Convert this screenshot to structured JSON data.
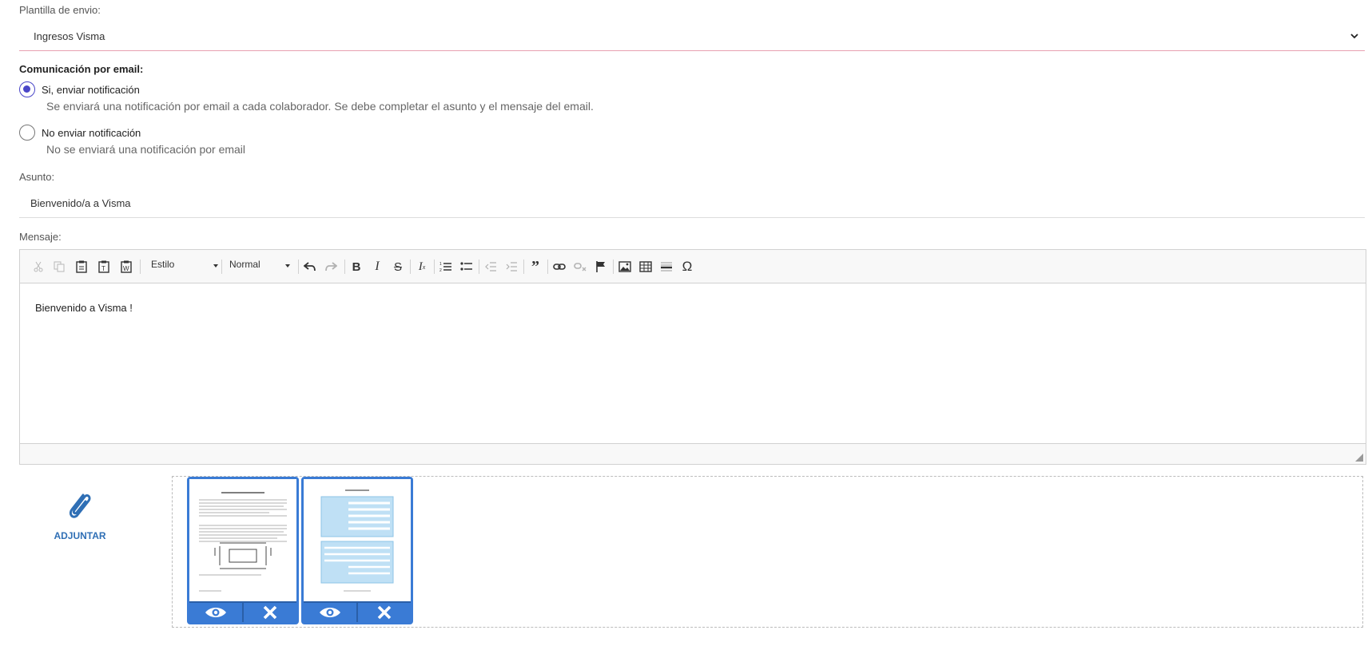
{
  "template": {
    "label": "Plantilla de envio:",
    "selected": "Ingresos Visma"
  },
  "email_comm": {
    "title": "Comunicación por email:",
    "options": [
      {
        "label": "Si, enviar notificación",
        "description": "Se enviará una notificación por email a cada colaborador. Se debe completar el asunto y el mensaje del email.",
        "checked": true
      },
      {
        "label": "No enviar notificación",
        "description": "No se enviará una notificación por email",
        "checked": false
      }
    ]
  },
  "subject": {
    "label": "Asunto:",
    "value": "Bienvenido/a a Visma"
  },
  "message": {
    "label": "Mensaje:",
    "style_combo": "Estilo",
    "format_combo": "Normal",
    "body": "Bienvenido a Visma !"
  },
  "attachments": {
    "button_label": "ADJUNTAR",
    "files": [
      {
        "kind": "document-thumbnail",
        "actions": [
          "view-icon",
          "remove-icon"
        ]
      },
      {
        "kind": "form-thumbnail",
        "actions": [
          "view-icon",
          "remove-icon"
        ]
      }
    ]
  },
  "colors": {
    "accent": "#4a46c8",
    "attach_blue": "#3a7bd5",
    "select_underline": "#e8a0b0"
  }
}
